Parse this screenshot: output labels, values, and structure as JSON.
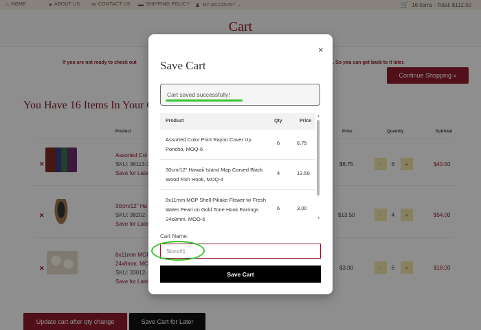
{
  "nav": {
    "home": "HOME",
    "about": "ABOUT US",
    "contact": "CONTACT US",
    "shipping": "SHIPPING POLICY",
    "account": "MY ACCOUNT",
    "cart_summary": "16 items - Total: $112.50"
  },
  "page": {
    "title": "Cart",
    "notice_left": "If you are not ready to check out",
    "notice_right": "n. So you can get back to it later.",
    "continue_label": "Continue Shopping »",
    "you_have": "You Have 16 Items In Your C"
  },
  "table": {
    "headers": {
      "product": "Product",
      "price": "Price",
      "quantity": "Quantity",
      "subtotal": "Subtotal"
    },
    "rows": [
      {
        "name": "Assorted Col",
        "sku": "SKU: 36113-3",
        "save": "Save for Late",
        "price": "$6.75",
        "qty": "6",
        "subtotal": "$40.50"
      },
      {
        "name": "30cm/12\" Ha",
        "sku": "SKU: 38202-",
        "save": "Save for Late",
        "price": "$13.50",
        "qty": "4",
        "subtotal": "$54.00"
      },
      {
        "name": "8x11mm MOP",
        "name2": "24x8mm, MC",
        "sku": "SKU: 33012-",
        "save": "Save for Late",
        "price": "$3.00",
        "qty": "6",
        "subtotal": "$18.00"
      }
    ],
    "minus": "-",
    "plus": "+",
    "remove": "✕"
  },
  "footer_buttons": {
    "update": "Update cart after qty change",
    "save_later": "Save Cart for Later"
  },
  "modal": {
    "title": "Save Cart",
    "close": "×",
    "success": "Cart saved successfully!",
    "headers": {
      "product": "Product",
      "qty": "Qty",
      "price": "Price"
    },
    "items": [
      {
        "name": "Assorted Color Print Rayon Cover Up Poncho, MOQ-6",
        "qty": "6",
        "price": "6.75"
      },
      {
        "name": "30cm/12\" Hawaii Island Map Carved Black Wood Fish Hook, MOQ-4",
        "qty": "4",
        "price": "13.50"
      },
      {
        "name": "8x11mm MOP Shell Pikake Flower w/ Fresh Water Pearl on Gold Tone Hook Earrings 24x8mm, MOQ-6",
        "qty": "6",
        "price": "3.00"
      }
    ],
    "cart_name_label": "Cart Name:",
    "cart_name_value": "Store#1",
    "save_label": "Save Cart"
  },
  "colors": {
    "brand": "#8a1a2b",
    "highlight": "#35c52b",
    "qty_button": "#e8dfa4"
  },
  "icons": {
    "home": "home-icon",
    "info": "info-icon",
    "mail": "envelope-icon",
    "truck": "truck-icon",
    "user": "user-icon",
    "cart": "cart-icon"
  }
}
